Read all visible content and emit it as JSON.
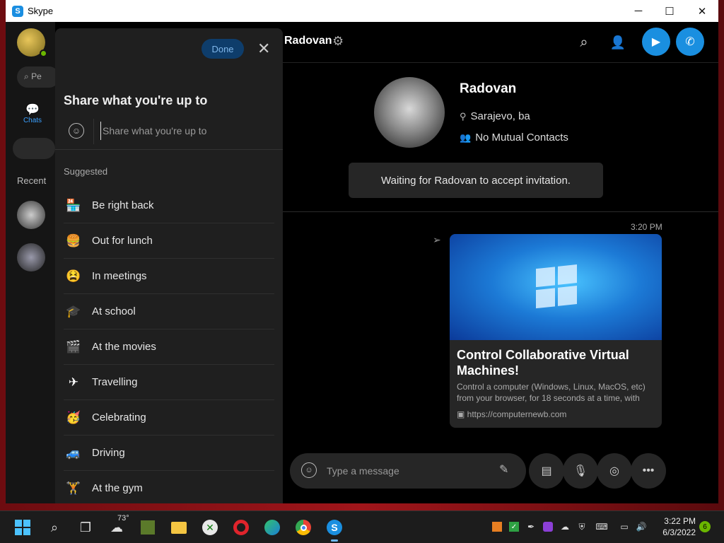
{
  "window": {
    "title": "Skype",
    "minimize": "─",
    "maximize": "☐",
    "close": "✕"
  },
  "sidebar": {
    "search_placeholder": "Pe",
    "chats_label": "Chats",
    "recent_label": "Recent"
  },
  "share_panel": {
    "done_label": "Done",
    "title": "Share what you're up to",
    "input_placeholder": "Share what you're up to",
    "suggested_label": "Suggested",
    "items": [
      {
        "emoji": "🏪",
        "label": "Be right back"
      },
      {
        "emoji": "🍔",
        "label": "Out for lunch"
      },
      {
        "emoji": "😫",
        "label": "In meetings"
      },
      {
        "emoji": "🎓",
        "label": "At school"
      },
      {
        "emoji": "🎬",
        "label": "At the movies"
      },
      {
        "emoji": "✈",
        "label": "Travelling"
      },
      {
        "emoji": "🥳",
        "label": "Celebrating"
      },
      {
        "emoji": "🚙",
        "label": "Driving"
      },
      {
        "emoji": "🏋",
        "label": "At the gym"
      }
    ]
  },
  "header": {
    "contact_name": "Radovan"
  },
  "profile": {
    "name": "Radovan",
    "location": "Sarajevo, ba",
    "mutual": "No Mutual Contacts",
    "waiting_text": "Waiting for Radovan to accept invitation."
  },
  "message": {
    "time": "3:20 PM",
    "card_title": "Control Collaborative Virtual Machines!",
    "card_desc": "Control a computer (Windows, Linux, MacOS, etc) from your browser, for 18 seconds at a time, with",
    "card_url": "https://computernewb.com"
  },
  "composer": {
    "placeholder": "Type a message"
  },
  "taskbar": {
    "weather_temp": "73°",
    "time": "3:22 PM",
    "date": "6/3/2022",
    "notification_count": "6"
  },
  "colors": {
    "accent": "#1a8fe0",
    "presence": "#6bb700",
    "done_bg": "#0e3d6b"
  }
}
